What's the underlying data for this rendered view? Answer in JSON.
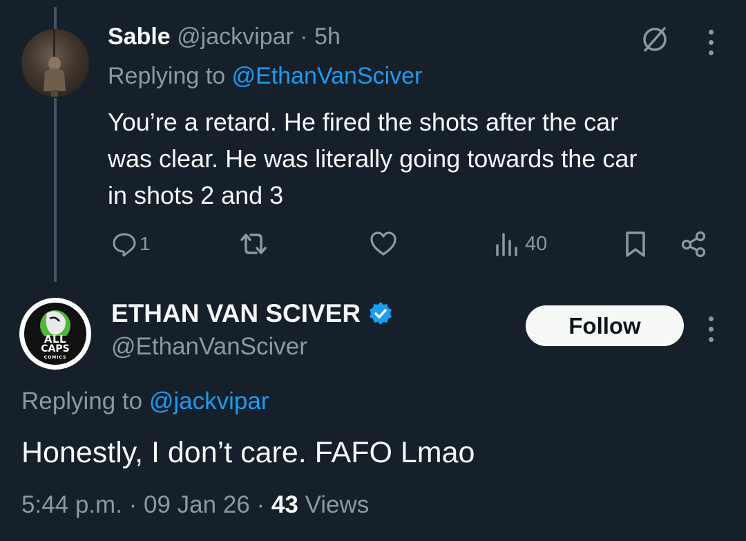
{
  "reply_tweet": {
    "display_name": "Sable",
    "handle": "@jackvipar",
    "separator": " · ",
    "time": "5h",
    "replying_prefix": "Replying to ",
    "replying_to": "@EthanVanSciver",
    "text_lines": [
      "You’re a retard. He fired the shots after the car",
      "was clear. He was literally going towards the car",
      "in shots 2 and 3"
    ],
    "actions": {
      "replies": "1",
      "views": "40"
    }
  },
  "main_tweet": {
    "display_name": "ETHAN VAN SCIVER",
    "handle": "@EthanVanSciver",
    "follow_label": "Follow",
    "replying_prefix": "Replying to ",
    "replying_to": "@jackvipar",
    "text": "Honestly, I don’t care. FAFO Lmao",
    "meta": {
      "time": "5:44 p.m.",
      "separator": " · ",
      "date": "09 Jan 26",
      "views_count": "43",
      "views_label": "Views"
    },
    "avatar_logo": {
      "line1": "ALL",
      "line2": "CAPS",
      "line3": "COMICS"
    }
  },
  "colors": {
    "background": "#15202b",
    "text": "#f7f9f9",
    "muted": "#8b98a5",
    "link": "#1d9bf0",
    "thread_line": "#425364",
    "verified": "#1d9bf0"
  },
  "icons": [
    "reply-icon",
    "retweet-icon",
    "like-icon",
    "views-icon",
    "bookmark-icon",
    "share-icon",
    "grok-slash-icon",
    "more-icon",
    "verified-badge-icon"
  ]
}
